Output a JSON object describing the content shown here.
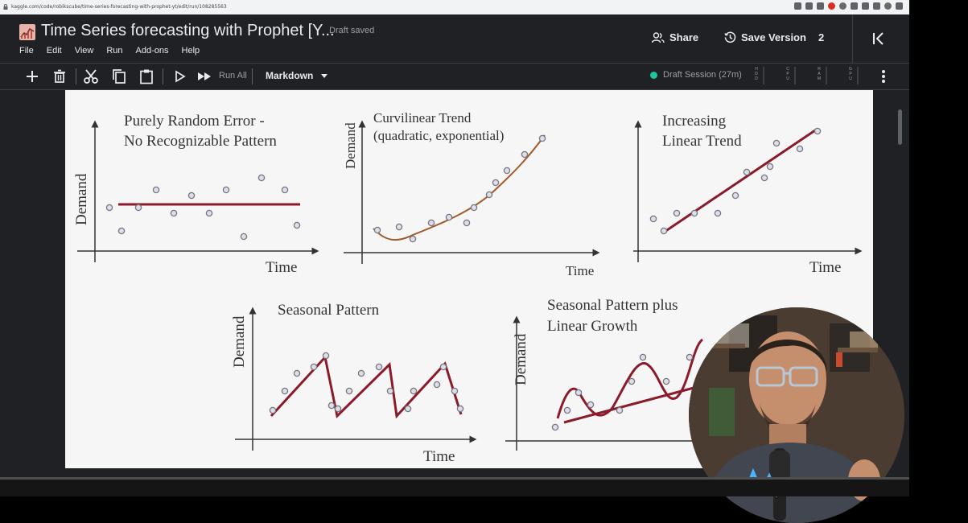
{
  "browser": {
    "url": "kaggle.com/code/robikscube/time-series-forecasting-with-prophet-yt/edit/run/108285563"
  },
  "header": {
    "notebook_title": "Time Series forecasting with Prophet [Y...",
    "save_status": "Draft saved",
    "share_label": "Share",
    "save_version_label": "Save Version",
    "version_count": "2"
  },
  "menu": {
    "items": [
      "File",
      "Edit",
      "View",
      "Run",
      "Add-ons",
      "Help"
    ]
  },
  "toolbar": {
    "run_all_label": "Run All",
    "cell_type": "Markdown",
    "session_status": "Draft Session (27m)",
    "session_color": "#1ec5a1",
    "meters": [
      "HDD",
      "CPU",
      "RAM",
      "GPU"
    ]
  },
  "slide": {
    "panels": [
      {
        "title_line1": "Purely Random Error -",
        "title_line2": "No Recognizable Pattern",
        "ylabel": "Demand",
        "xlabel": "Time"
      },
      {
        "title_line1": "Curvilinear Trend",
        "title_line2": "(quadratic, exponential)",
        "ylabel": "Demand",
        "xlabel": "Time"
      },
      {
        "title_line1": "Increasing",
        "title_line2": "Linear Trend",
        "ylabel": "",
        "xlabel": "Time"
      },
      {
        "title_line1": "Seasonal Pattern",
        "title_line2": "",
        "ylabel": "Demand",
        "xlabel": "Time"
      },
      {
        "title_line1": "Seasonal Pattern plus",
        "title_line2": "Linear Growth",
        "ylabel": "Demand",
        "xlabel": ""
      }
    ],
    "line_color": "#8b1a2b",
    "curve_color": "#a05a2c"
  },
  "video": {
    "progress_percent": 0
  }
}
